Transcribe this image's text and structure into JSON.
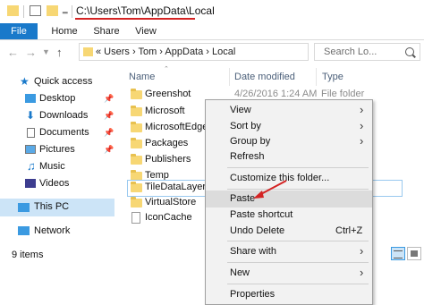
{
  "title_bar": {
    "path": "C:\\Users\\Tom\\AppData\\Local"
  },
  "ribbon": {
    "tabs": [
      "File",
      "Home",
      "Share",
      "View"
    ]
  },
  "address_bar": {
    "crumbs": "«  Users  ›  Tom  ›  AppData  ›  Local",
    "search_placeholder": "Search Lo..."
  },
  "nav": {
    "items": [
      {
        "label": "Quick access"
      },
      {
        "label": "Desktop"
      },
      {
        "label": "Downloads"
      },
      {
        "label": "Documents"
      },
      {
        "label": "Pictures"
      },
      {
        "label": "Music"
      },
      {
        "label": "Videos"
      },
      {
        "label": "This PC"
      },
      {
        "label": "Network"
      }
    ]
  },
  "columns": {
    "name": "Name",
    "date": "Date modified",
    "type": "Type"
  },
  "files": [
    {
      "name": "Greenshot",
      "date": "4/26/2016 1:24 AM",
      "type": "File folder"
    },
    {
      "name": "Microsoft"
    },
    {
      "name": "MicrosoftEdge"
    },
    {
      "name": "Packages"
    },
    {
      "name": "Publishers"
    },
    {
      "name": "Temp"
    },
    {
      "name": "TileDataLayer"
    },
    {
      "name": "VirtualStore"
    },
    {
      "name": "IconCache"
    }
  ],
  "status": {
    "items": "9 items"
  },
  "context_menu": {
    "view": "View",
    "sort_by": "Sort by",
    "group_by": "Group by",
    "refresh": "Refresh",
    "customize": "Customize this folder...",
    "paste": "Paste",
    "paste_shortcut": "Paste shortcut",
    "undo_delete": "Undo Delete",
    "undo_shortcut": "Ctrl+Z",
    "share_with": "Share with",
    "new": "New",
    "properties": "Properties"
  },
  "colors": {
    "accent": "#1979ca",
    "annotation_red": "#d42424",
    "selection": "#cce4f7"
  }
}
